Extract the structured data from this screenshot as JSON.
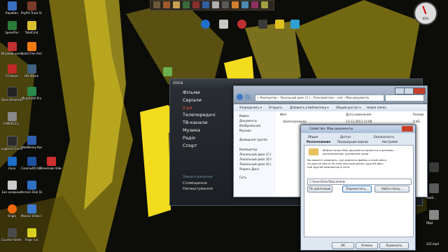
{
  "desktop_icons": [
    {
      "label": "Карабин",
      "color": "#3a6fc2"
    },
    {
      "label": "PayPal Truck Sim",
      "color": "#7a3a2a"
    },
    {
      "label": "SpeedFan",
      "color": "#2a7a3a"
    },
    {
      "label": "TotalCmd",
      "color": "#d8c030"
    },
    {
      "label": "Игровой центр@Mail",
      "color": "#c03030"
    },
    {
      "label": "Avast Free Antivirus",
      "color": "#f07a10"
    },
    {
      "label": "CCleaner",
      "color": "#c02828"
    },
    {
      "label": "HD VDeck",
      "color": "#406080"
    },
    {
      "label": "Open Broadcast",
      "color": "#222222"
    },
    {
      "label": "MorphVOX Pro",
      "color": "#2a8a4a"
    },
    {
      "label": "CAM00123...",
      "color": "#888888"
    },
    {
      "label": "Logitech Gaming",
      "color": "#2a2a2a"
    },
    {
      "label": "WebMoney Keeper W...",
      "color": "#2f5fb0"
    },
    {
      "label": "Zona",
      "color": "#1d6fc9"
    },
    {
      "label": "Cinema4D 64Bit",
      "color": "#2050a0"
    },
    {
      "label": "Freemake Video Co...",
      "color": "#d03030"
    },
    {
      "label": "Без названия",
      "color": "#cccccc"
    },
    {
      "label": "Acronis Disk Director Suite",
      "color": "#3070c0"
    },
    {
      "label": "Origin",
      "color": "#f06a10"
    },
    {
      "label": "Movavi Video Converter",
      "color": "#3d7bd0"
    },
    {
      "label": "Counter-Strike Global...",
      "color": "#4a4a4a"
    },
    {
      "label": "Fraps run",
      "color": "#d8d020"
    }
  ],
  "top_icons": [
    {
      "label": "",
      "color": "#1e70c8"
    },
    {
      "label": "",
      "color": "#c8c8c8"
    },
    {
      "label": "",
      "color": "#c03030"
    },
    {
      "label": "",
      "color": "#3a3a3a"
    },
    {
      "label": "",
      "color": "#e0c020"
    },
    {
      "label": "",
      "color": "#30a0d0"
    }
  ],
  "gauge": {
    "value": "60%"
  },
  "zona": {
    "logo": "zona",
    "menu": [
      "Фільми",
      "Серіали",
      "Ігри",
      "Телепередачі",
      "ТВ-канали",
      "Музика",
      "Радіо",
      "Спорт"
    ],
    "active_index": 2,
    "sub": [
      "Завантаження",
      "Сповіщення",
      "Налаштування"
    ],
    "badge": "0"
  },
  "explorer": {
    "address": "« Компьютер › Локальный диск (C:) › Пользователи › user › Мои документы",
    "toolbar": [
      "Упорядочить ▾",
      "Открыть",
      "Добавить в библиотеку ▾",
      "Общий доступ ▾",
      "Новая папка"
    ],
    "nav": [
      "Видео",
      "Документы",
      "Изображения",
      "Музыка",
      "Домашняя группа",
      "Компьютер",
      "Локальный диск (C:)",
      "Локальный диск (D:)",
      "Локальный диск (E:)",
      "Яндекс.Диск",
      "Сеть"
    ],
    "files": [
      {
        "name": "Имя",
        "date": "Дата изменения",
        "type": "Тип",
        "size": "Размер"
      },
      {
        "name": "daemonprosvea",
        "date": "13.12.2013 15:08",
        "type": "",
        "size": "0 КБ"
      }
    ]
  },
  "props": {
    "title": "Свойства: Мои документы",
    "tabs_row1": [
      "Общие",
      "Доступ",
      "Безопасность"
    ],
    "tabs_row2": [
      "Расположение",
      "Предыдущие версии",
      "Настройка"
    ],
    "desc1": [
      "Файлы папки Мои документы хранятся в целевом",
      "расположении, указанном ниже."
    ],
    "desc2": [
      "Вы можете изменить, где хранятся файлы в этой папке,",
      "на другое место на этом жестком диске, другой диск",
      "или другой компьютер в сети."
    ],
    "path": "C:\\Users\\User\\Documents",
    "buttons": [
      "По умолчанию",
      "Переместить...",
      "Найти папку..."
    ],
    "footer_buttons": [
      "ОК",
      "Отмена",
      "Применить"
    ]
  },
  "right_panel": [
    "text2...",
    "122.mp4",
    "tftp2"
  ]
}
